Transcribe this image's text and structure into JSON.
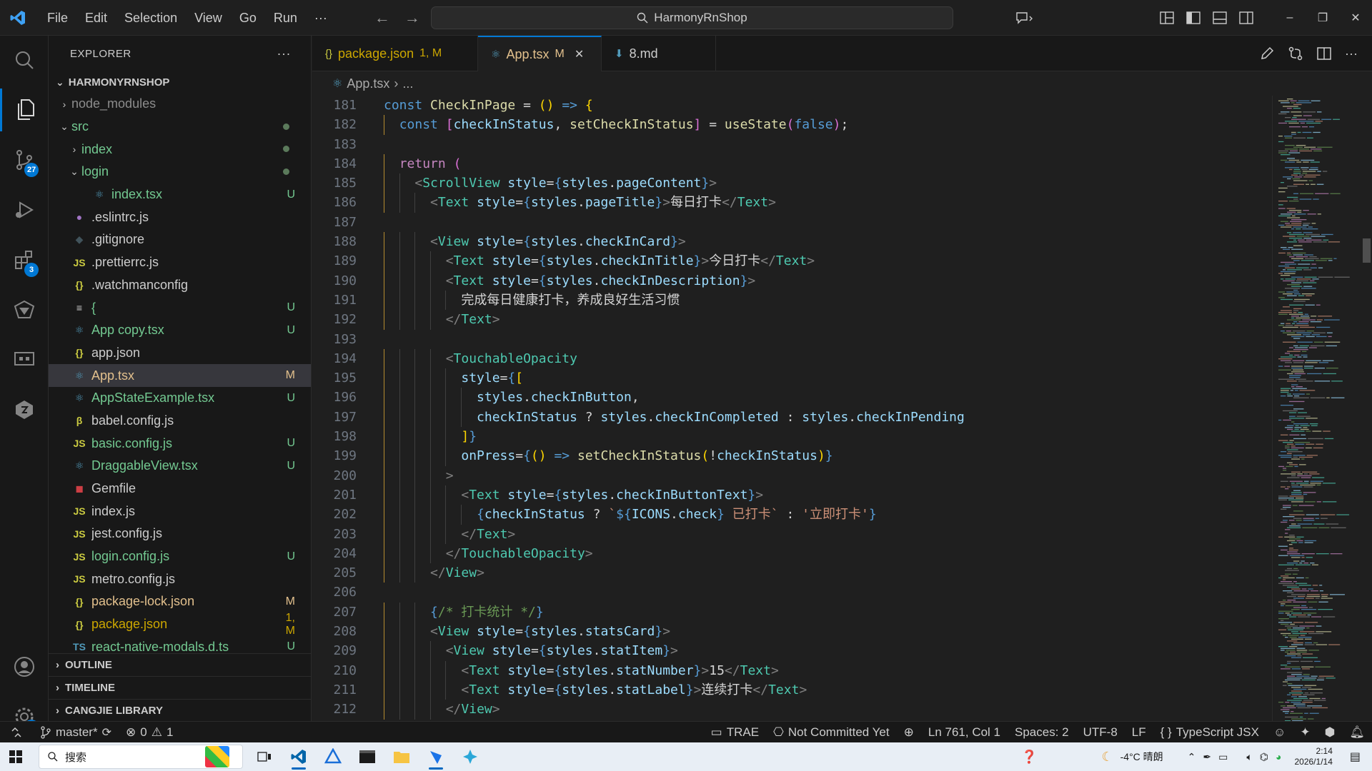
{
  "menu": [
    "File",
    "Edit",
    "Selection",
    "View",
    "Go",
    "Run",
    "···"
  ],
  "search": {
    "text": "HarmonyRnShop"
  },
  "window_controls": {
    "minimize": "–",
    "restore": "❐",
    "close": "✕"
  },
  "activity": {
    "scm_badge": "27",
    "extensions_badge": "3",
    "settings_badge": "1"
  },
  "sidebar": {
    "title": "EXPLORER",
    "more": "···",
    "project": "HARMONYRNSHOP",
    "items": [
      {
        "name": "node_modules",
        "chev": "›",
        "indent": 1,
        "icon": "",
        "status": "",
        "color": "#8c8c8c"
      },
      {
        "name": "src",
        "chev": "⌄",
        "indent": 1,
        "icon": "",
        "status": "dot",
        "color": "#73c991"
      },
      {
        "name": "index",
        "chev": "›",
        "indent": 2,
        "icon": "",
        "status": "dot",
        "color": "#73c991"
      },
      {
        "name": "login",
        "chev": "⌄",
        "indent": 2,
        "icon": "",
        "status": "dot",
        "color": "#73c991"
      },
      {
        "name": "index.tsx",
        "chev": "",
        "indent": 3,
        "icon": "⚛",
        "icon_color": "#519aba",
        "status": "U",
        "color": "#73c991"
      },
      {
        "name": ".eslintrc.js",
        "chev": "",
        "indent": 1,
        "icon": "●",
        "icon_color": "#a074c4",
        "status": "",
        "color": "#cccccc"
      },
      {
        "name": ".gitignore",
        "chev": "",
        "indent": 1,
        "icon": "◆",
        "icon_color": "#41535b",
        "status": "",
        "color": "#cccccc"
      },
      {
        "name": ".prettierrc.js",
        "chev": "",
        "indent": 1,
        "icon": "JS",
        "icon_color": "#cbcb41",
        "status": "",
        "color": "#cccccc"
      },
      {
        "name": ".watchmanconfig",
        "chev": "",
        "indent": 1,
        "icon": "{}",
        "icon_color": "#cbcb41",
        "status": "",
        "color": "#cccccc"
      },
      {
        "name": "{",
        "chev": "",
        "indent": 1,
        "icon": "≡",
        "icon_color": "#cccccc",
        "status": "U",
        "color": "#73c991"
      },
      {
        "name": "App copy.tsx",
        "chev": "",
        "indent": 1,
        "icon": "⚛",
        "icon_color": "#519aba",
        "status": "U",
        "color": "#73c991"
      },
      {
        "name": "app.json",
        "chev": "",
        "indent": 1,
        "icon": "{}",
        "icon_color": "#cbcb41",
        "status": "",
        "color": "#cccccc"
      },
      {
        "name": "App.tsx",
        "chev": "",
        "indent": 1,
        "icon": "⚛",
        "icon_color": "#519aba",
        "status": "M",
        "color": "#e2c08d",
        "selected": true
      },
      {
        "name": "AppStateExample.tsx",
        "chev": "",
        "indent": 1,
        "icon": "⚛",
        "icon_color": "#519aba",
        "status": "U",
        "color": "#73c991"
      },
      {
        "name": "babel.config.js",
        "chev": "",
        "indent": 1,
        "icon": "β",
        "icon_color": "#cbcb41",
        "status": "",
        "color": "#cccccc"
      },
      {
        "name": "basic.config.js",
        "chev": "",
        "indent": 1,
        "icon": "JS",
        "icon_color": "#cbcb41",
        "status": "U",
        "color": "#73c991"
      },
      {
        "name": "DraggableView.tsx",
        "chev": "",
        "indent": 1,
        "icon": "⚛",
        "icon_color": "#519aba",
        "status": "U",
        "color": "#73c991"
      },
      {
        "name": "Gemfile",
        "chev": "",
        "indent": 1,
        "icon": "◼",
        "icon_color": "#cc3e44",
        "status": "",
        "color": "#cccccc"
      },
      {
        "name": "index.js",
        "chev": "",
        "indent": 1,
        "icon": "JS",
        "icon_color": "#cbcb41",
        "status": "",
        "color": "#cccccc"
      },
      {
        "name": "jest.config.js",
        "chev": "",
        "indent": 1,
        "icon": "JS",
        "icon_color": "#cbcb41",
        "status": "",
        "color": "#cccccc"
      },
      {
        "name": "login.config.js",
        "chev": "",
        "indent": 1,
        "icon": "JS",
        "icon_color": "#cbcb41",
        "status": "U",
        "color": "#73c991"
      },
      {
        "name": "metro.config.js",
        "chev": "",
        "indent": 1,
        "icon": "JS",
        "icon_color": "#cbcb41",
        "status": "",
        "color": "#cccccc"
      },
      {
        "name": "package-lock.json",
        "chev": "",
        "indent": 1,
        "icon": "{}",
        "icon_color": "#cbcb41",
        "status": "M",
        "color": "#e2c08d"
      },
      {
        "name": "package.json",
        "chev": "",
        "indent": 1,
        "icon": "{}",
        "icon_color": "#cbcb41",
        "status": "1, M",
        "color": "#cca700"
      },
      {
        "name": "react-native-modals.d.ts",
        "chev": "",
        "indent": 1,
        "icon": "TS",
        "icon_color": "#519aba",
        "status": "U",
        "color": "#73c991"
      }
    ],
    "sections": [
      "OUTLINE",
      "TIMELINE",
      "CANGJIE LIBRARY"
    ]
  },
  "tabs": [
    {
      "icon": "{}",
      "label": "package.json",
      "status": "1, M",
      "color": "#cca700",
      "active": false
    },
    {
      "icon": "⚛",
      "label": "App.tsx",
      "status": "M",
      "color": "#e2c08d",
      "active": true
    },
    {
      "icon": "⬇",
      "label": "8.md",
      "status": "",
      "color": "#cccccc",
      "active": false
    }
  ],
  "breadcrumb": {
    "file": "App.tsx",
    "rest": "..."
  },
  "code": [
    {
      "n": "181",
      "i": 0,
      "h": "<span class='kw'>const</span> <span class='fn'>CheckInPage</span> <span class='pun'>=</span> <span class='br1'>()</span> <span class='kw'>=&gt;</span> <span class='br1'>{</span>"
    },
    {
      "n": "182",
      "i": 1,
      "h": "<span class='kw'>const</span> <span class='br2'>[</span><span class='var'>checkInStatus</span><span class='pun'>,</span> <span class='fn'>setCheckInStatus</span><span class='br2'>]</span> <span class='pun'>=</span> <span class='fn'>useState</span><span class='br2'>(</span><span class='kw'>false</span><span class='br2'>)</span><span class='pun'>;</span>"
    },
    {
      "n": "183",
      "i": 0,
      "h": ""
    },
    {
      "n": "184",
      "i": 1,
      "h": "<span class='kw2'>return</span> <span class='br2'>(</span>"
    },
    {
      "n": "185",
      "i": 2,
      "h": "<span class='tag'>&lt;</span><span class='cl'>ScrollView</span> <span class='var'>style</span><span class='pun'>=</span><span class='kw'>{</span><span class='var'>styles</span><span class='pun'>.</span><span class='var'>pageContent</span><span class='kw'>}</span><span class='tag'>&gt;</span>"
    },
    {
      "n": "186",
      "i": 3,
      "h": "<span class='tag'>&lt;</span><span class='cl'>Text</span> <span class='var'>style</span><span class='pun'>=</span><span class='kw'>{</span><span class='var'>styles</span><span class='pun'>.</span><span class='var'>pageTitle</span><span class='kw'>}</span><span class='tag'>&gt;</span><span class='txt'>每日打卡</span><span class='tag'>&lt;/</span><span class='cl'>Text</span><span class='tag'>&gt;</span>"
    },
    {
      "n": "187",
      "i": 0,
      "h": ""
    },
    {
      "n": "188",
      "i": 3,
      "h": "<span class='tag'>&lt;</span><span class='cl'>View</span> <span class='var'>style</span><span class='pun'>=</span><span class='kw'>{</span><span class='var'>styles</span><span class='pun'>.</span><span class='var'>checkInCard</span><span class='kw'>}</span><span class='tag'>&gt;</span>"
    },
    {
      "n": "189",
      "i": 4,
      "h": "<span class='tag'>&lt;</span><span class='cl'>Text</span> <span class='var'>style</span><span class='pun'>=</span><span class='kw'>{</span><span class='var'>styles</span><span class='pun'>.</span><span class='var'>checkInTitle</span><span class='kw'>}</span><span class='tag'>&gt;</span><span class='txt'>今日打卡</span><span class='tag'>&lt;/</span><span class='cl'>Text</span><span class='tag'>&gt;</span>"
    },
    {
      "n": "190",
      "i": 4,
      "h": "<span class='tag'>&lt;</span><span class='cl'>Text</span> <span class='var'>style</span><span class='pun'>=</span><span class='kw'>{</span><span class='var'>styles</span><span class='pun'>.</span><span class='var'>checkInDescription</span><span class='kw'>}</span><span class='tag'>&gt;</span>"
    },
    {
      "n": "191",
      "i": 5,
      "h": "<span class='txt'>完成每日健康打卡，养成良好生活习惯</span>"
    },
    {
      "n": "192",
      "i": 4,
      "h": "<span class='tag'>&lt;/</span><span class='cl'>Text</span><span class='tag'>&gt;</span>"
    },
    {
      "n": "193",
      "i": 0,
      "h": ""
    },
    {
      "n": "194",
      "i": 4,
      "h": "<span class='tag'>&lt;</span><span class='cl'>TouchableOpacity</span>"
    },
    {
      "n": "195",
      "i": 5,
      "h": "<span class='var'>style</span><span class='pun'>=</span><span class='kw'>{</span><span class='br1'>[</span>"
    },
    {
      "n": "196",
      "i": 6,
      "h": "<span class='var'>styles</span><span class='pun'>.</span><span class='var'>checkInButton</span><span class='pun'>,</span>"
    },
    {
      "n": "197",
      "i": 6,
      "h": "<span class='var'>checkInStatus</span> <span class='pun'>?</span> <span class='var'>styles</span><span class='pun'>.</span><span class='var'>checkInCompleted</span> <span class='pun'>:</span> <span class='var'>styles</span><span class='pun'>.</span><span class='var'>checkInPending</span>"
    },
    {
      "n": "198",
      "i": 5,
      "h": "<span class='br1'>]</span><span class='kw'>}</span>"
    },
    {
      "n": "199",
      "i": 5,
      "h": "<span class='var'>onPress</span><span class='pun'>=</span><span class='kw'>{</span><span class='br1'>()</span> <span class='kw'>=&gt;</span> <span class='fn'>setCheckInStatus</span><span class='br1'>(</span><span class='pun'>!</span><span class='var'>checkInStatus</span><span class='br1'>)</span><span class='kw'>}</span>"
    },
    {
      "n": "200",
      "i": 4,
      "h": "<span class='tag'>&gt;</span>"
    },
    {
      "n": "201",
      "i": 5,
      "h": "<span class='tag'>&lt;</span><span class='cl'>Text</span> <span class='var'>style</span><span class='pun'>=</span><span class='kw'>{</span><span class='var'>styles</span><span class='pun'>.</span><span class='var'>checkInButtonText</span><span class='kw'>}</span><span class='tag'>&gt;</span>"
    },
    {
      "n": "202",
      "i": 6,
      "h": "<span class='kw'>{</span><span class='var'>checkInStatus</span> <span class='pun'>?</span> <span class='str'>`</span><span class='kw'>${</span><span class='var'>ICONS</span><span class='pun'>.</span><span class='var'>check</span><span class='kw'>}</span><span class='str'> 已打卡`</span> <span class='pun'>:</span> <span class='str'>'立即打卡'</span><span class='kw'>}</span>"
    },
    {
      "n": "203",
      "i": 5,
      "h": "<span class='tag'>&lt;/</span><span class='cl'>Text</span><span class='tag'>&gt;</span>"
    },
    {
      "n": "204",
      "i": 4,
      "h": "<span class='tag'>&lt;/</span><span class='cl'>TouchableOpacity</span><span class='tag'>&gt;</span>"
    },
    {
      "n": "205",
      "i": 3,
      "h": "<span class='tag'>&lt;/</span><span class='cl'>View</span><span class='tag'>&gt;</span>"
    },
    {
      "n": "206",
      "i": 0,
      "h": ""
    },
    {
      "n": "207",
      "i": 3,
      "h": "<span class='kw'>{</span><span class='cm'>/* 打卡统计 */</span><span class='kw'>}</span>"
    },
    {
      "n": "208",
      "i": 3,
      "h": "<span class='tag'>&lt;</span><span class='cl'>View</span> <span class='var'>style</span><span class='pun'>=</span><span class='kw'>{</span><span class='var'>styles</span><span class='pun'>.</span><span class='var'>statsCard</span><span class='kw'>}</span><span class='tag'>&gt;</span>"
    },
    {
      "n": "209",
      "i": 4,
      "h": "<span class='tag'>&lt;</span><span class='cl'>View</span> <span class='var'>style</span><span class='pun'>=</span><span class='kw'>{</span><span class='var'>styles</span><span class='pun'>.</span><span class='var'>statItem</span><span class='kw'>}</span><span class='tag'>&gt;</span>"
    },
    {
      "n": "210",
      "i": 5,
      "h": "<span class='tag'>&lt;</span><span class='cl'>Text</span> <span class='var'>style</span><span class='pun'>=</span><span class='kw'>{</span><span class='var'>styles</span><span class='pun'>.</span><span class='var'>statNumber</span><span class='kw'>}</span><span class='tag'>&gt;</span><span class='txt'>15</span><span class='tag'>&lt;/</span><span class='cl'>Text</span><span class='tag'>&gt;</span>"
    },
    {
      "n": "211",
      "i": 5,
      "h": "<span class='tag'>&lt;</span><span class='cl'>Text</span> <span class='var'>style</span><span class='pun'>=</span><span class='kw'>{</span><span class='var'>styles</span><span class='pun'>.</span><span class='var'>statLabel</span><span class='kw'>}</span><span class='tag'>&gt;</span><span class='txt'>连续打卡</span><span class='tag'>&lt;/</span><span class='cl'>Text</span><span class='tag'>&gt;</span>"
    },
    {
      "n": "212",
      "i": 4,
      "h": "<span class='tag'>&lt;/</span><span class='cl'>View</span><span class='tag'>&gt;</span>"
    }
  ],
  "status": {
    "branch": "master*",
    "errors": "0",
    "warnings": "1",
    "trae": "TRAE",
    "blame": "Not Committed Yet",
    "position": "Ln 761, Col 1",
    "spaces": "Spaces: 2",
    "encoding": "UTF-8",
    "eol": "LF",
    "language": "TypeScript JSX"
  },
  "taskbar": {
    "search": "搜索",
    "weather": "-4°C 晴朗",
    "time": "2:14",
    "date": "2026/1/14"
  }
}
